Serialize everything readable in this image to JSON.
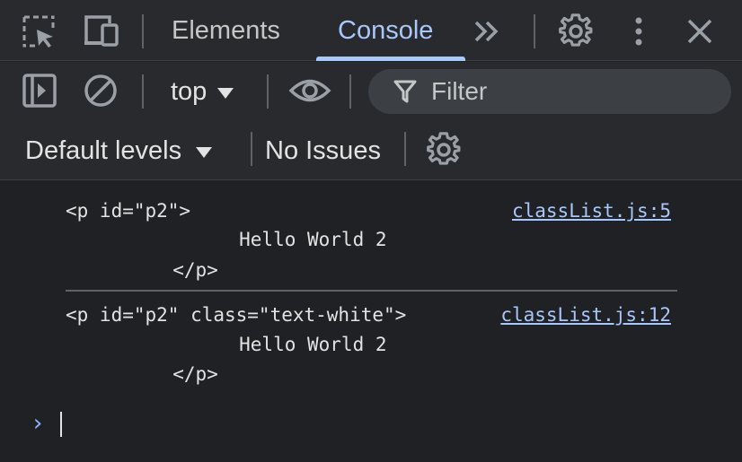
{
  "tabbar": {
    "tabs": [
      {
        "label": "Elements",
        "active": false
      },
      {
        "label": "Console",
        "active": true
      }
    ],
    "icons": [
      "select-element-icon",
      "device-toolbar-icon",
      "more-tabs-icon",
      "settings-icon",
      "kebab-menu-icon",
      "close-icon"
    ]
  },
  "toolbar": {
    "context": "top",
    "filter_placeholder": "Filter",
    "levels": "Default levels",
    "issues": "No Issues",
    "icons": [
      "sidebar-toggle-icon",
      "clear-console-icon",
      "live-expression-eye-icon",
      "filter-icon",
      "console-settings-icon"
    ]
  },
  "console": {
    "messages": [
      {
        "lines": [
          "<p id=\"p2\">",
          "        Hello World 2",
          "     </p>"
        ],
        "source": "classList.js:5"
      },
      {
        "lines": [
          "<p id=\"p2\" class=\"text-white\">",
          "        Hello World 2",
          "     </p>"
        ],
        "source": "classList.js:12"
      }
    ],
    "prompt_symbol": "›"
  },
  "colors": {
    "background": "#202124",
    "toolbar": "#282a2e",
    "accent": "#a8c7fa",
    "text": "#e3e3e3"
  }
}
